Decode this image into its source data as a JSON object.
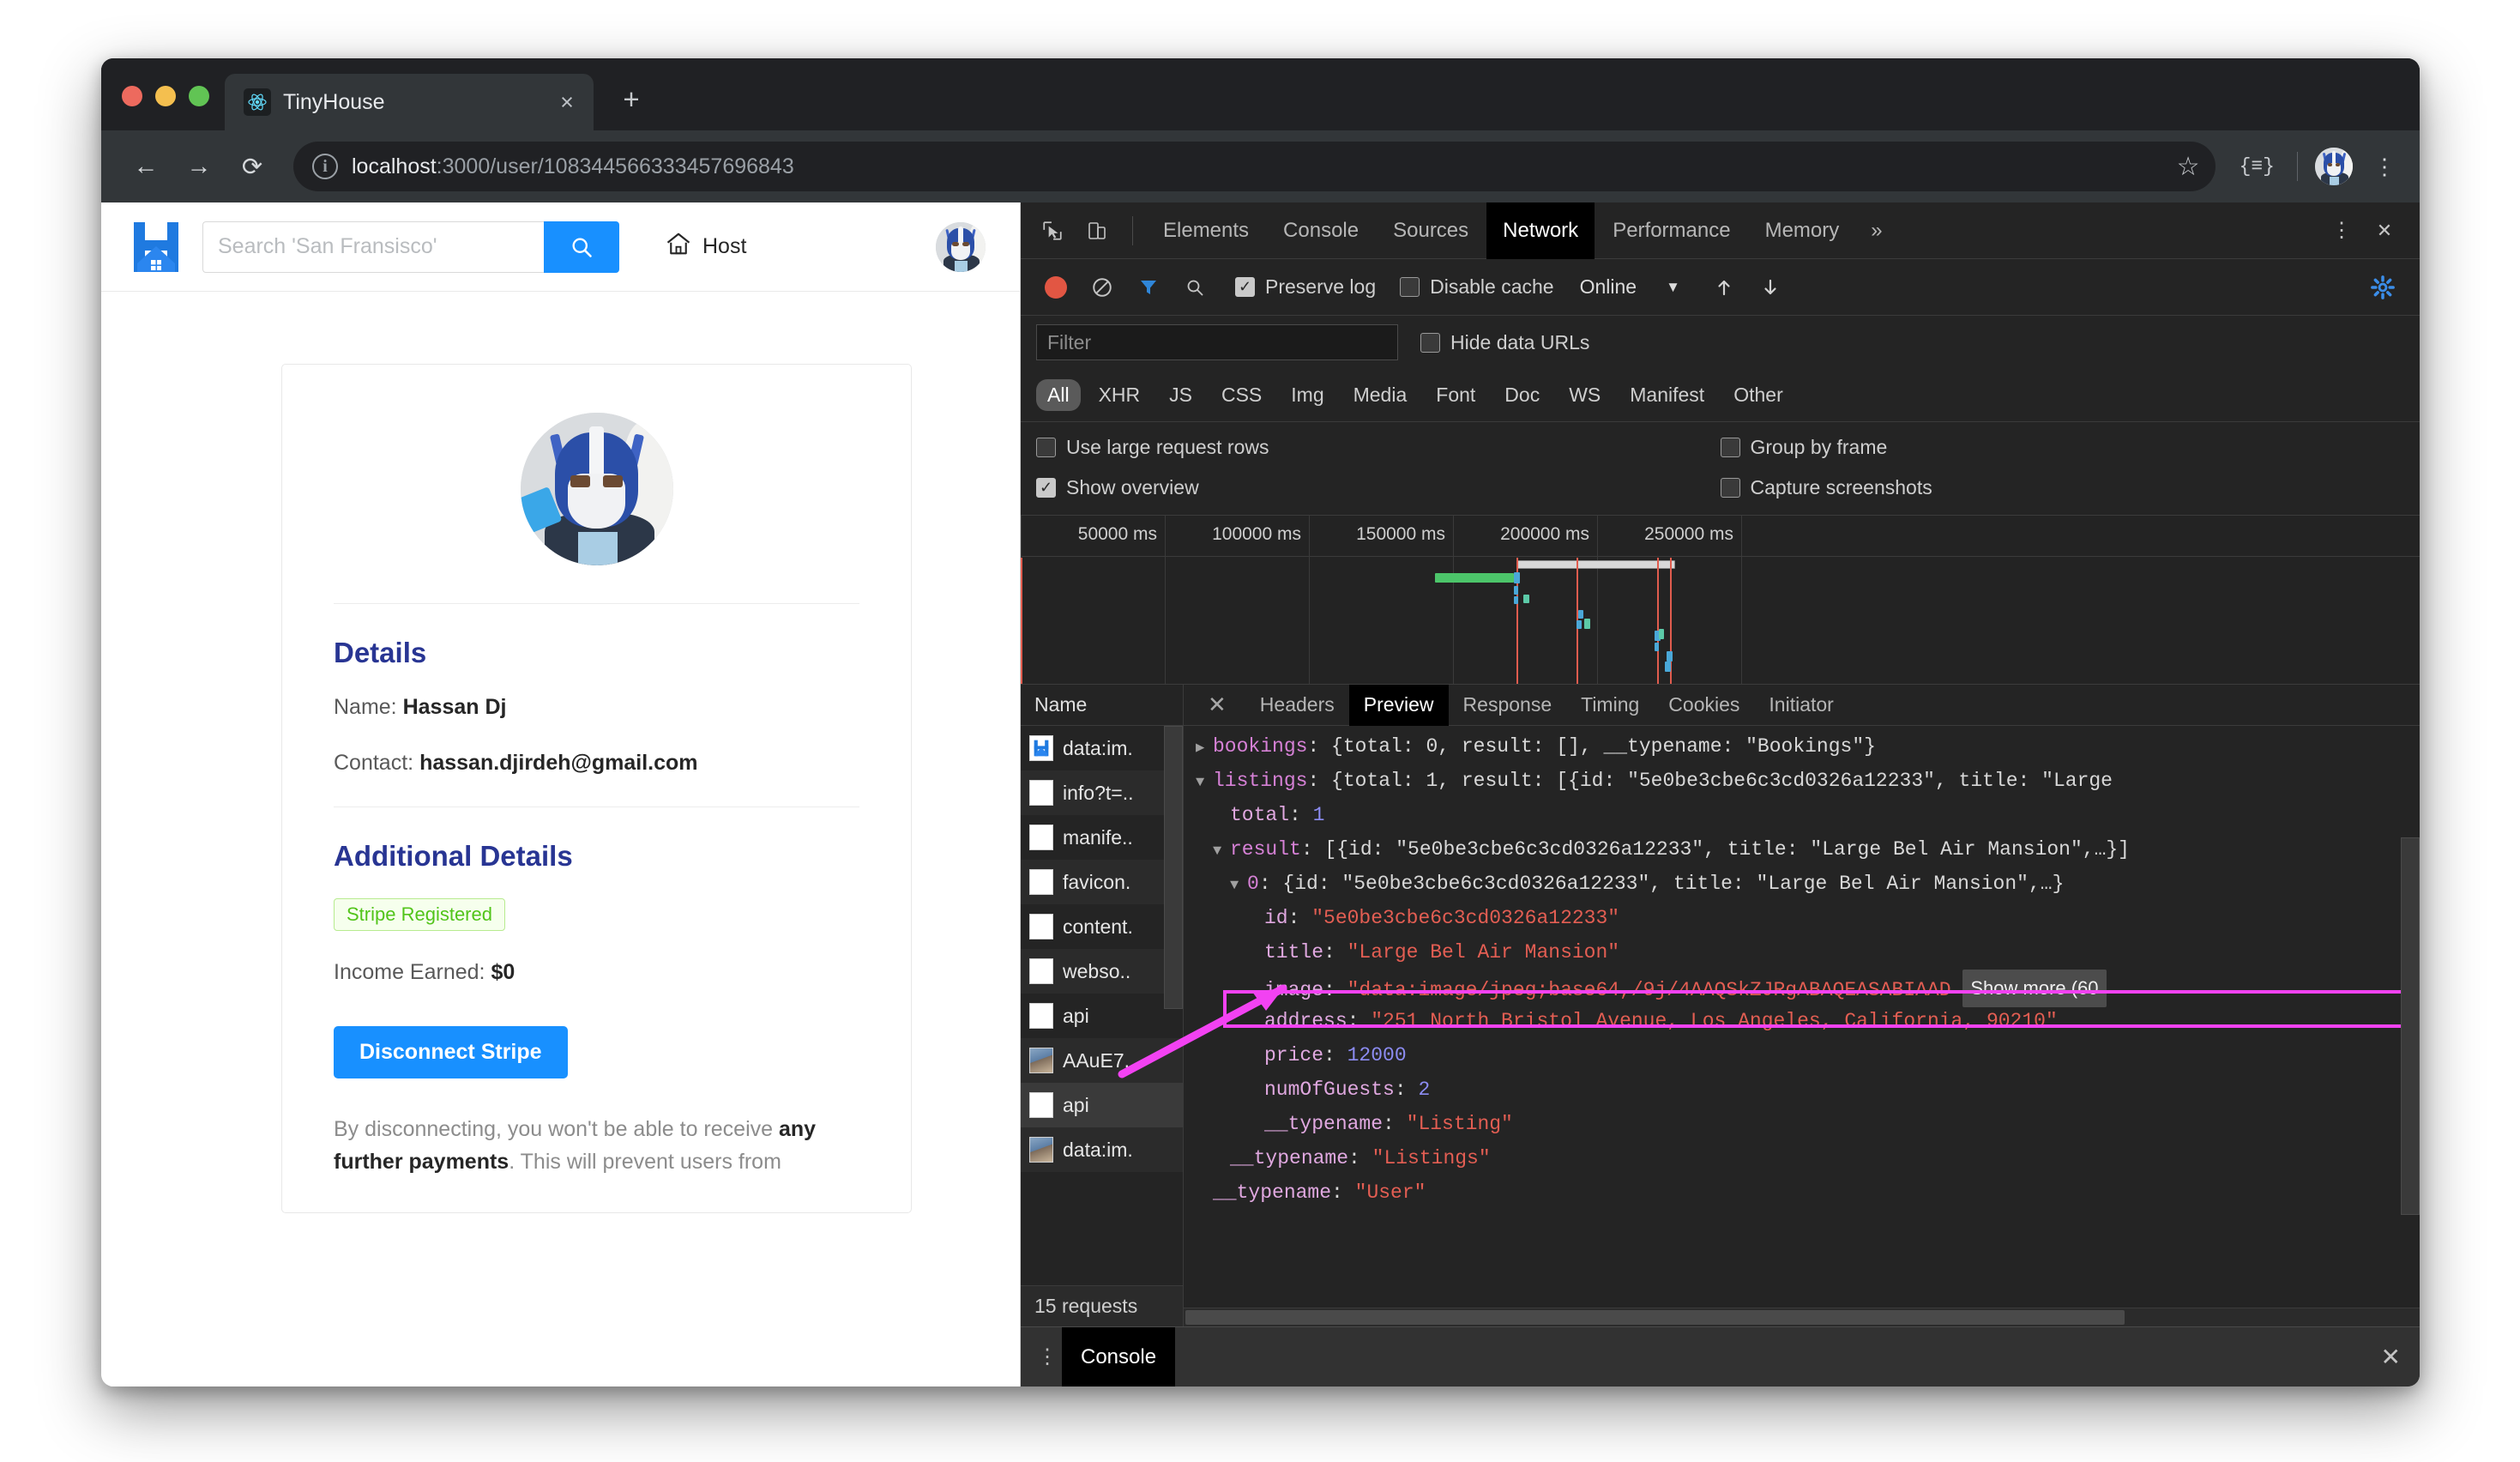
{
  "browser": {
    "tab_title": "TinyHouse",
    "tab_favicon": "react-icon",
    "close_label": "×",
    "new_tab_label": "+",
    "back_label": "←",
    "forward_label": "→",
    "reload_label": "⟳",
    "url_host": "localhost",
    "url_path": ":3000/user/108344566333457696843",
    "star_label": "☆",
    "extension_label": "{≡}",
    "kebab_label": "⋮"
  },
  "page": {
    "logo": "tinyhouse-logo",
    "search_placeholder": "Search 'San Fransisco'",
    "search_value": "",
    "search_button_icon": "search-icon",
    "host_label": "Host",
    "host_icon": "home-icon",
    "card": {
      "details_title": "Details",
      "name_label": "Name:",
      "name_value": "Hassan Dj",
      "contact_label": "Contact:",
      "contact_value": "hassan.djirdeh@gmail.com",
      "additional_title": "Additional Details",
      "stripe_badge": "Stripe Registered",
      "income_label": "Income Earned:",
      "income_value": "$0",
      "disconnect_button": "Disconnect Stripe",
      "note_part1": "By disconnecting, you won't be able to receive ",
      "note_bold1": "any further payments",
      "note_part2": ". This will prevent users from"
    }
  },
  "devtools": {
    "inspect_icon": "inspect-element-icon",
    "device_icon": "device-toolbar-icon",
    "panels": [
      {
        "label": "Elements",
        "active": false
      },
      {
        "label": "Console",
        "active": false
      },
      {
        "label": "Sources",
        "active": false
      },
      {
        "label": "Network",
        "active": true
      },
      {
        "label": "Performance",
        "active": false
      },
      {
        "label": "Memory",
        "active": false
      }
    ],
    "more_panels_label": "»",
    "settings_icon": "gear-icon",
    "kebab_label": "⋮",
    "close_label": "✕",
    "network_toolbar": {
      "record_icon": "record-stop-icon",
      "clear_icon": "clear-icon",
      "filter_icon": "funnel-icon",
      "search_icon": "search-icon",
      "preserve_log_label": "Preserve log",
      "preserve_log_checked": true,
      "disable_cache_label": "Disable cache",
      "disable_cache_checked": false,
      "throttle_value": "Online",
      "throttle_caret": "▼",
      "import_icon": "upload-icon",
      "export_icon": "download-icon"
    },
    "filter_placeholder": "Filter",
    "filter_value": "",
    "hide_data_urls_label": "Hide data URLs",
    "hide_data_urls_checked": false,
    "type_filters": [
      {
        "label": "All",
        "active": true
      },
      {
        "label": "XHR",
        "active": false
      },
      {
        "label": "JS",
        "active": false
      },
      {
        "label": "CSS",
        "active": false
      },
      {
        "label": "Img",
        "active": false
      },
      {
        "label": "Media",
        "active": false
      },
      {
        "label": "Font",
        "active": false
      },
      {
        "label": "Doc",
        "active": false
      },
      {
        "label": "WS",
        "active": false
      },
      {
        "label": "Manifest",
        "active": false
      },
      {
        "label": "Other",
        "active": false
      }
    ],
    "options": [
      {
        "label": "Use large request rows",
        "checked": false
      },
      {
        "label": "Group by frame",
        "checked": false
      },
      {
        "label": "Show overview",
        "checked": true
      },
      {
        "label": "Capture screenshots",
        "checked": false
      }
    ],
    "overview_ticks": [
      "50000 ms",
      "100000 ms",
      "150000 ms",
      "200000 ms",
      "250000 ms"
    ],
    "requests_header": "Name",
    "requests": [
      {
        "name": "data:im.",
        "icon": "logo-thumb"
      },
      {
        "name": "info?t=..",
        "icon": "doc"
      },
      {
        "name": "manife..",
        "icon": "doc"
      },
      {
        "name": "favicon.",
        "icon": "doc"
      },
      {
        "name": "content.",
        "icon": "doc"
      },
      {
        "name": "webso..",
        "icon": "doc"
      },
      {
        "name": "api",
        "icon": "doc"
      },
      {
        "name": "AAuE7..",
        "icon": "img-thumb"
      },
      {
        "name": "api",
        "icon": "doc"
      },
      {
        "name": "data:im.",
        "icon": "img-thumb"
      }
    ],
    "requests_footer": "15 requests",
    "detail_close_label": "✕",
    "detail_tabs": [
      {
        "label": "Headers",
        "active": false
      },
      {
        "label": "Preview",
        "active": true
      },
      {
        "label": "Response",
        "active": false
      },
      {
        "label": "Timing",
        "active": false
      },
      {
        "label": "Cookies",
        "active": false
      },
      {
        "label": "Initiator",
        "active": false
      }
    ],
    "preview": {
      "line_bookings_key": "bookings",
      "line_bookings_value": ": {total: 0, result: [], __typename: \"Bookings\"}",
      "line_listings_key": "listings",
      "line_listings_value": ": {total: 1, result: [{id: \"5e0be3cbe6c3cd0326a12233\", title: \"Large",
      "line_total_key": "total",
      "line_total_value": "1",
      "line_result_key": "result",
      "line_result_value": ": [{id: \"5e0be3cbe6c3cd0326a12233\", title: \"Large Bel Air Mansion\",…}]",
      "line_zero_key": "0",
      "line_zero_value": ": {id: \"5e0be3cbe6c3cd0326a12233\", title: \"Large Bel Air Mansion\",…}",
      "line_id_key": "id",
      "line_id_value": "\"5e0be3cbe6c3cd0326a12233\"",
      "line_title_key": "title",
      "line_title_value": "\"Large Bel Air Mansion\"",
      "line_image_key": "image",
      "line_image_value": "\"data:image/jpeg;base64,/9j/4AAQSkZJRgABAQEASABIAAD",
      "show_more_label": "Show more (60",
      "line_address_key": "address",
      "line_address_value": "\"251 North Bristol Avenue, Los Angeles, California, 90210\"",
      "line_price_key": "price",
      "line_price_value": "12000",
      "line_guests_key": "numOfGuests",
      "line_guests_value": "2",
      "line_typename_listing_key": "__typename",
      "line_typename_listing_value": "\"Listing\"",
      "line_typename_listings_key": "__typename",
      "line_typename_listings_value": "\"Listings\"",
      "line_typename_user_key": "__typename",
      "line_typename_user_value": "\"User\""
    },
    "console_drawer": {
      "kebab_label": "⋮",
      "tab_label": "Console",
      "close_label": "✕"
    }
  },
  "colors": {
    "accent_blue": "#1890ff",
    "badge_green": "#52c41a",
    "highlight_magenta": "#f242f2",
    "devtools_bg": "#242424"
  }
}
